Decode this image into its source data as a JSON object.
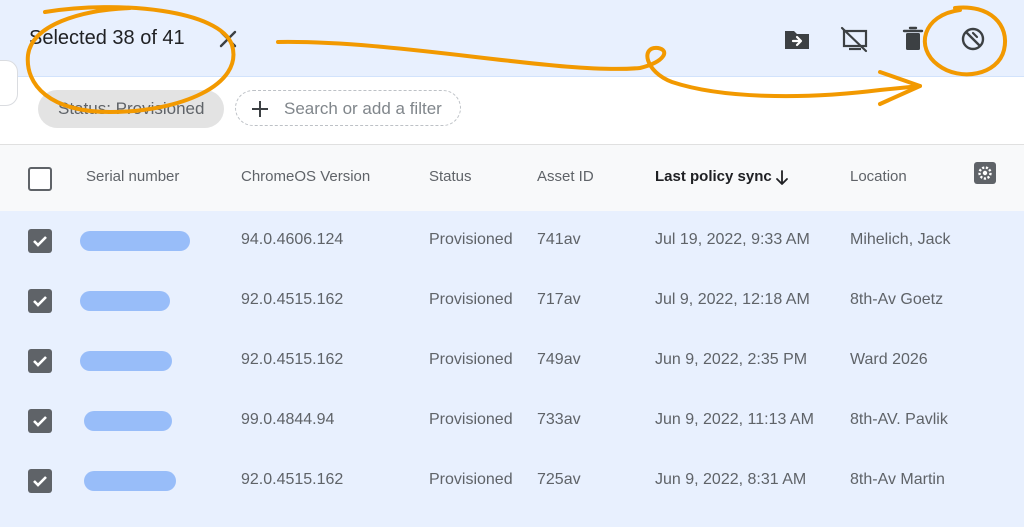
{
  "selection": {
    "text": "Selected 38 of 41"
  },
  "toolbar": {
    "actions": [
      {
        "name": "move-to-folder-icon"
      },
      {
        "name": "disable-device-icon"
      },
      {
        "name": "delete-icon"
      },
      {
        "name": "deprovision-icon"
      }
    ]
  },
  "filters": {
    "chip_label": "Status: Provisioned",
    "search_placeholder": "Search or add a filter"
  },
  "table": {
    "columns": [
      {
        "label": "Serial number"
      },
      {
        "label": "ChromeOS Version"
      },
      {
        "label": "Status"
      },
      {
        "label": "Asset ID"
      },
      {
        "label": "Last policy sync",
        "sorted": "descending"
      },
      {
        "label": "Location"
      }
    ],
    "rows": [
      {
        "checked": true,
        "serial": "",
        "version": "94.0.4606.124",
        "status": "Provisioned",
        "asset_id": "741av",
        "last_sync": "Jul 19, 2022, 9:33 AM",
        "location": "Mihelich, Jack"
      },
      {
        "checked": true,
        "serial": "",
        "version": "92.0.4515.162",
        "status": "Provisioned",
        "asset_id": "717av",
        "last_sync": "Jul 9, 2022, 12:18 AM",
        "location": "8th-Av Goetz"
      },
      {
        "checked": true,
        "serial": "",
        "version": "92.0.4515.162",
        "status": "Provisioned",
        "asset_id": "749av",
        "last_sync": "Jun 9, 2022, 2:35 PM",
        "location": "Ward 2026"
      },
      {
        "checked": true,
        "serial": "",
        "version": "99.0.4844.94",
        "status": "Provisioned",
        "asset_id": "733av",
        "last_sync": "Jun 9, 2022, 11:13 AM",
        "location": "8th-AV. Pavlik"
      },
      {
        "checked": true,
        "serial": "",
        "version": "92.0.4515.162",
        "status": "Provisioned",
        "asset_id": "725av",
        "last_sync": "Jun 9, 2022, 8:31 AM",
        "location": "8th-Av Martin"
      }
    ]
  },
  "colors": {
    "selection_bg": "#e8f0fe",
    "annotation": "#f29900",
    "redaction": "#8ab4f8"
  }
}
